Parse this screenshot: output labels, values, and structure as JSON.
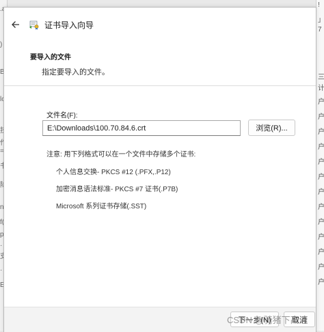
{
  "title_bar": {
    "title": "证书导入向导"
  },
  "header": {
    "section_title": "要导入的文件",
    "section_subtitle": "指定要导入的文件。"
  },
  "file": {
    "label": "文件名(F):",
    "value": "E:\\Downloads\\100.70.84.6.crt",
    "browse_label": "浏览(R)..."
  },
  "note": "注意: 用下列格式可以在一个文件中存储多个证书:",
  "formats": [
    "个人信息交换- PKCS #12 (.PFX,.P12)",
    "加密消息语法标准- PKCS #7 证书(.P7B)",
    "Microsoft 系列证书存储(.SST)"
  ],
  "footer": {
    "next_label": "下一步(N)",
    "cancel_label": "取消"
  },
  "watermark": "CSDN @骑猪下高速",
  "background_fragments": {
    "left": [
      ".a",
      ")",
      "B",
      "lc",
      "技",
      "作",
      "=",
      "书",
      "除",
      "n",
      "f(",
      "p",
      "·",
      "支",
      "·",
      "E"
    ],
    "right": [
      "!",
      "」",
      "7",
      "三",
      "计",
      "户",
      "户",
      "户",
      "户",
      "户",
      "户",
      "户",
      "户",
      "户",
      "户",
      "户",
      "户",
      "户"
    ]
  },
  "colors": {
    "dialog_bg": "#ffffff",
    "footer_bg": "#f3f3f3",
    "accent": "#1a73c8"
  },
  "icons": {
    "back": "back-arrow-icon",
    "wizard": "certificate-wizard-icon"
  }
}
